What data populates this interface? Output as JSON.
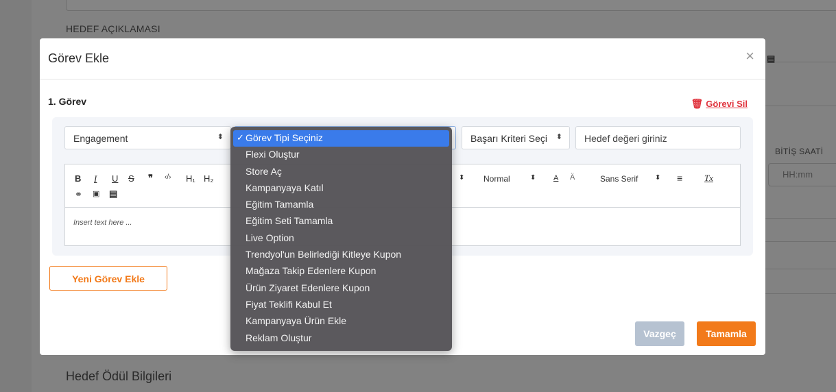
{
  "background": {
    "section_label": "HEDEF AÇIKLAMASI",
    "end_time_label": "BİTİŞ SAATİ",
    "end_time_placeholder": "HH:mm",
    "reward_title": "Hedef Ödül Bilgileri"
  },
  "modal": {
    "title": "Görev Ekle",
    "close_icon": "×",
    "task_title": "1. Görev",
    "delete_label": "Görevi Sil",
    "engagement_select": "Engagement",
    "success_select": "Başarı Kriteri Seçi",
    "target_placeholder": "Hedef değeri giriniz",
    "editor": {
      "toolbar": {
        "bold": "B",
        "italic": "I",
        "underline": "U",
        "strike": "S",
        "quote": "❞",
        "code": "‹/›",
        "h1": "H₁",
        "h2": "H₂",
        "size_value": "Normal",
        "font_value": "Sans Serif",
        "clear_format": "Tx"
      },
      "placeholder": "Insert text here ..."
    },
    "add_task_label": "Yeni Görev Ekle",
    "cancel_label": "Vazgeç",
    "complete_label": "Tamamla"
  },
  "dropdown": {
    "options": [
      "Görev Tipi Seçiniz",
      "Flexi Oluştur",
      "Store Aç",
      "Kampanyaya Katıl",
      "Eğitim Tamamla",
      "Eğitim Seti Tamamla",
      "Live Option",
      "Trendyol'un Belirlediği Kitleye Kupon",
      "Mağaza Takip Edenlere Kupon",
      "Ürün Ziyaret Edenlere Kupon",
      "Fiyat Teklifi Kabul Et",
      "Kampanyaya Ürün Ekle",
      "Reklam Oluştur"
    ],
    "selected_index": 0
  },
  "colors": {
    "accent": "#f27a1a",
    "danger": "#e0323c",
    "selected": "#3a7bea"
  }
}
